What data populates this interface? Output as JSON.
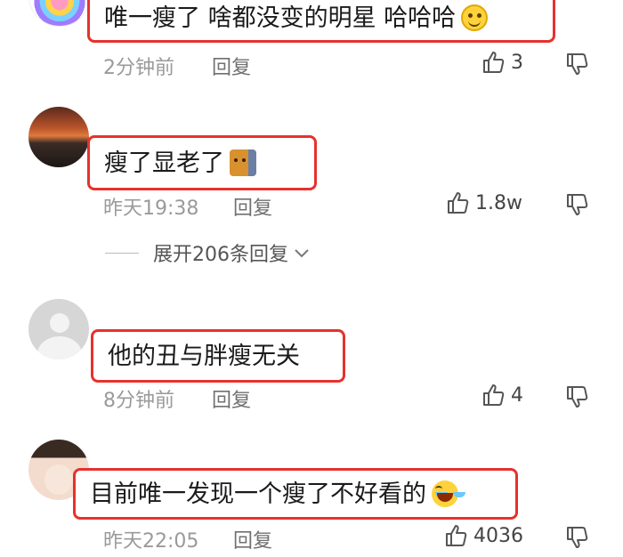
{
  "comments": [
    {
      "text": "唯一瘦了  啥都没变的明星 哈哈哈",
      "emoji": "smile-emoji",
      "time": "2分钟前",
      "reply": "回复",
      "likes": "3"
    },
    {
      "text": "瘦了显老了",
      "emoji": "cat-emoji",
      "time": "昨天19:38",
      "reply": "回复",
      "likes": "1.8w"
    },
    {
      "text": "他的丑与胖瘦无关",
      "time": "8分钟前",
      "reply": "回复",
      "likes": "4"
    },
    {
      "text": "目前唯一发现一个瘦了不好看的",
      "emoji": "laughing-crying-emoji",
      "time": "昨天22:05",
      "reply": "回复",
      "likes": "4036"
    }
  ],
  "expand_replies": "展开206条回复",
  "highlight_color": "#e5322d"
}
